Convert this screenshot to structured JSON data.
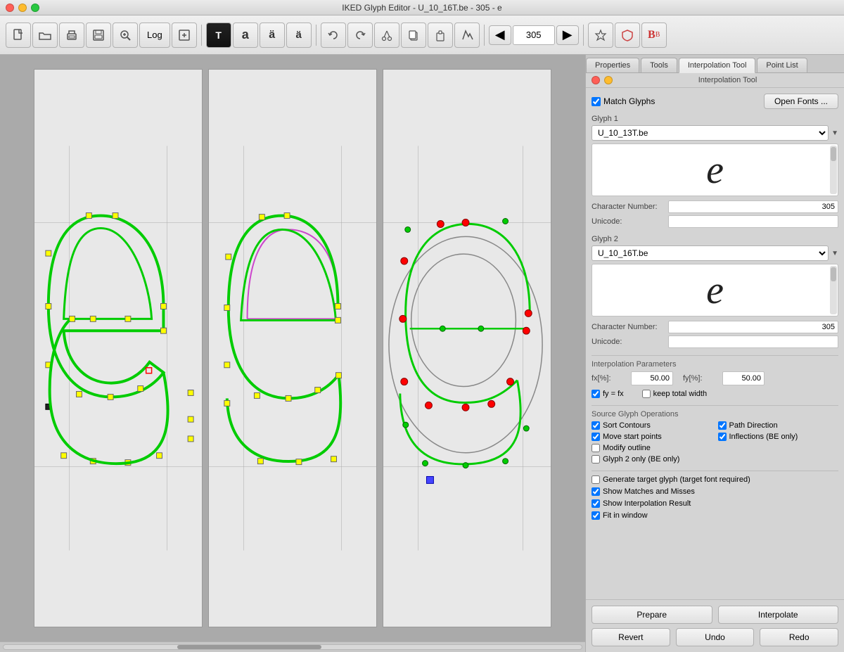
{
  "window": {
    "title": "IKED Glyph Editor - U_10_16T.be - 305 - e"
  },
  "toolbar": {
    "log_label": "Log",
    "nav_value": "305",
    "nav_placeholder": "305"
  },
  "tabs": {
    "items": [
      "Properties",
      "Tools",
      "Interpolation Tool",
      "Point List"
    ],
    "active": "Interpolation Tool"
  },
  "panel_header": {
    "title": "Interpolation Tool"
  },
  "interpolation": {
    "match_glyphs_label": "Match Glyphs",
    "open_fonts_label": "Open Fonts ...",
    "glyph1_label": "Glyph 1",
    "glyph1_value": "U_10_13T.be",
    "glyph1_char": "e",
    "glyph1_char_number_label": "Character Number:",
    "glyph1_char_number": "305",
    "glyph1_unicode_label": "Unicode:",
    "glyph1_unicode": "",
    "glyph2_label": "Glyph 2",
    "glyph2_value": "U_10_16T.be",
    "glyph2_char": "e",
    "glyph2_char_number_label": "Character Number:",
    "glyph2_char_number": "305",
    "glyph2_unicode_label": "Unicode:",
    "glyph2_unicode": "",
    "params_label": "Interpolation Parameters",
    "fx_label": "fx[%]:",
    "fx_value": "50.00",
    "fy_label": "fy[%]:",
    "fy_value": "50.00",
    "fy_equals_fx_label": "fy = fx",
    "keep_total_width_label": "keep total width",
    "source_ops_label": "Source Glyph Operations",
    "sort_contours_label": "Sort Contours",
    "path_direction_label": "Path Direction",
    "move_start_points_label": "Move start points",
    "inflections_label": "Inflections (BE only)",
    "modify_outline_label": "Modify outline",
    "glyph2_only_label": "Glyph 2 only (BE only)",
    "generate_target_label": "Generate target glyph (target font required)",
    "show_matches_label": "Show Matches and Misses",
    "show_interp_label": "Show Interpolation Result",
    "fit_window_label": "Fit in window",
    "prepare_label": "Prepare",
    "interpolate_label": "Interpolate",
    "revert_label": "Revert",
    "undo_label": "Undo",
    "redo_label": "Redo"
  },
  "checkboxes": {
    "match_glyphs": true,
    "fy_equals_fx": true,
    "keep_total_width": false,
    "sort_contours": true,
    "path_direction": true,
    "move_start_points": true,
    "inflections": true,
    "modify_outline": false,
    "glyph2_only": false,
    "generate_target": false,
    "show_matches": true,
    "show_interp": true,
    "fit_window": true
  },
  "icons": {
    "new_file": "🗋",
    "open": "📂",
    "print": "🖨",
    "save": "💾",
    "zoom": "🔍",
    "back": "◀",
    "forward": "▶",
    "star": "✦",
    "shield": "🛡",
    "B": "B"
  }
}
